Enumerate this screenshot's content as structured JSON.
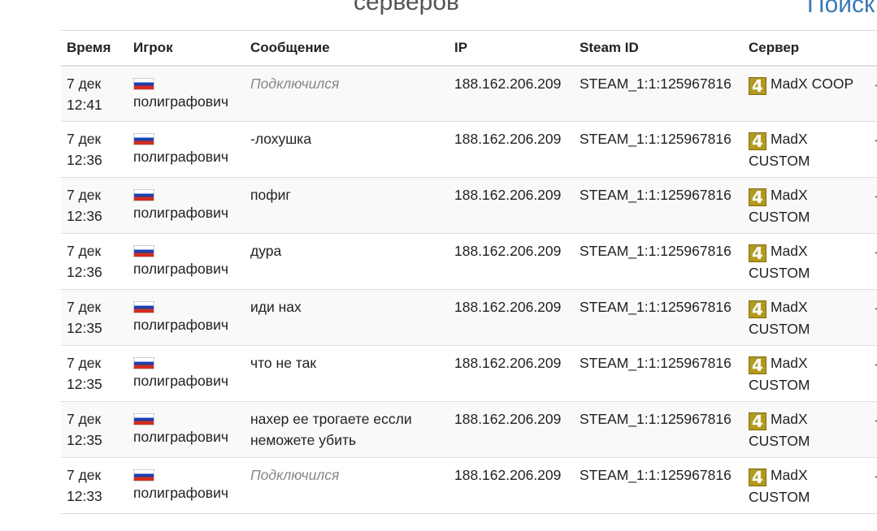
{
  "heading": "серверов",
  "search_label": "Поиск",
  "table": {
    "headers": {
      "time": "Время",
      "player": "Игрок",
      "message": "Сообщение",
      "ip": "IP",
      "steam_id": "Steam ID",
      "server": "Сервер"
    },
    "rows": [
      {
        "date": "7 дек",
        "time": "12:41",
        "flag": "russia-flag-icon",
        "player": "полиграфович",
        "message": "Подключился",
        "message_type": "system",
        "ip": "188.162.206.209",
        "steam_id": "STEAM_1:1:125967816",
        "server": "MadX COOP"
      },
      {
        "date": "7 дек",
        "time": "12:36",
        "flag": "russia-flag-icon",
        "player": "полиграфович",
        "message": "-лохушка",
        "message_type": "chat",
        "ip": "188.162.206.209",
        "steam_id": "STEAM_1:1:125967816",
        "server": "MadX CUSTOM"
      },
      {
        "date": "7 дек",
        "time": "12:36",
        "flag": "russia-flag-icon",
        "player": "полиграфович",
        "message": "пофиг",
        "message_type": "chat",
        "ip": "188.162.206.209",
        "steam_id": "STEAM_1:1:125967816",
        "server": "MadX CUSTOM"
      },
      {
        "date": "7 дек",
        "time": "12:36",
        "flag": "russia-flag-icon",
        "player": "полиграфович",
        "message": "дура",
        "message_type": "chat",
        "ip": "188.162.206.209",
        "steam_id": "STEAM_1:1:125967816",
        "server": "MadX CUSTOM"
      },
      {
        "date": "7 дек",
        "time": "12:35",
        "flag": "russia-flag-icon",
        "player": "полиграфович",
        "message": "иди нах",
        "message_type": "chat",
        "ip": "188.162.206.209",
        "steam_id": "STEAM_1:1:125967816",
        "server": "MadX CUSTOM"
      },
      {
        "date": "7 дек",
        "time": "12:35",
        "flag": "russia-flag-icon",
        "player": "полиграфович",
        "message": "что не так",
        "message_type": "chat",
        "ip": "188.162.206.209",
        "steam_id": "STEAM_1:1:125967816",
        "server": "MadX CUSTOM"
      },
      {
        "date": "7 дек",
        "time": "12:35",
        "flag": "russia-flag-icon",
        "player": "полиграфович",
        "message": "нахер ее трогаете ессли неможете убить",
        "message_type": "chat",
        "ip": "188.162.206.209",
        "steam_id": "STEAM_1:1:125967816",
        "server": "MadX CUSTOM"
      },
      {
        "date": "7 дек",
        "time": "12:33",
        "flag": "russia-flag-icon",
        "player": "полиграфович",
        "message": "Подключился",
        "message_type": "system",
        "ip": "188.162.206.209",
        "steam_id": "STEAM_1:1:125967816",
        "server": "MadX CUSTOM"
      }
    ]
  },
  "server_icon": {
    "glyph": "4",
    "name": "l4d2-game-icon",
    "color": "#b39a1f"
  },
  "colors": {
    "link": "#3a7ab8",
    "system_message": "#888888",
    "stripe": "#f9f9f9",
    "border": "#dddddd"
  }
}
